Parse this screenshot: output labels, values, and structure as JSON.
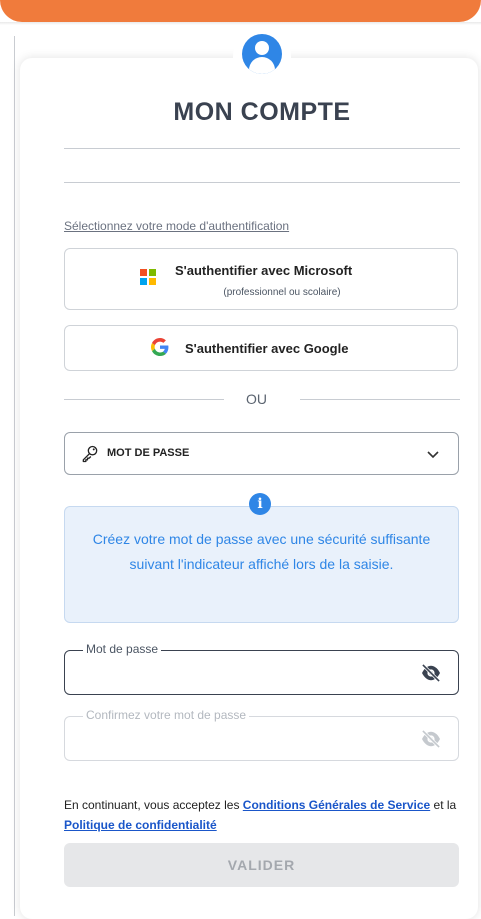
{
  "header": {
    "title": "MON COMPTE"
  },
  "auth": {
    "mode_label": "Sélectionnez votre mode d'authentification",
    "microsoft": {
      "label": "S'authentifier avec Microsoft",
      "sublabel": "(professionnel ou scolaire)"
    },
    "google": {
      "label": "S'authentifier avec Google"
    },
    "separator": "OU"
  },
  "method_select": {
    "value": "MOT DE PASSE"
  },
  "info": {
    "text": "Créez votre mot de passe avec une sécurité suffisante suivant l'indicateur affiché lors de la saisie."
  },
  "password": {
    "label": "Mot de passe",
    "value": ""
  },
  "confirm_password": {
    "label": "Confirmez votre mot de passe",
    "value": ""
  },
  "terms": {
    "prefix": "En continuant, vous acceptez les",
    "cgs_link": "Conditions Générales de Service",
    "middle": "et la",
    "privacy_link": "Politique de confidentialité"
  },
  "submit": {
    "label": "VALIDER"
  },
  "colors": {
    "accent": "#f07b3c",
    "primary": "#2f86e6",
    "info_bg": "#e9f1fb",
    "link": "#1a56c9"
  },
  "icons": [
    "user-icon",
    "microsoft-logo-icon",
    "google-logo-icon",
    "key-icon",
    "chevron-down-icon",
    "info-icon",
    "eye-off-icon"
  ]
}
